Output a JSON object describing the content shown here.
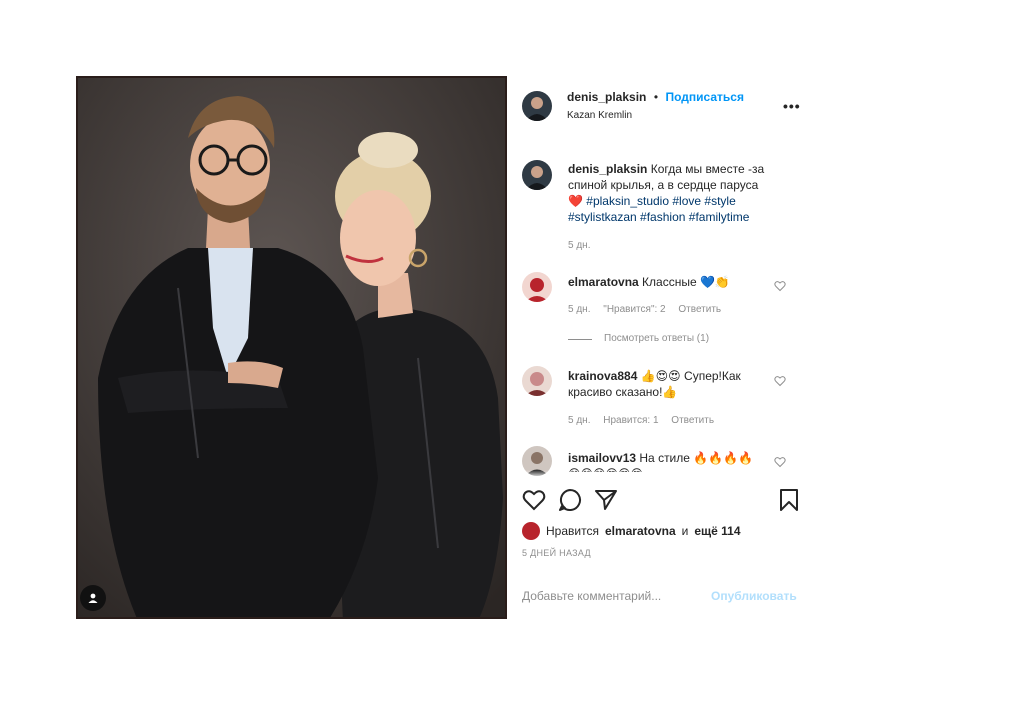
{
  "post": {
    "author": "denis_plaksin",
    "follow_label": "Подписаться",
    "dot": "•",
    "location": "Kazan Kremlin",
    "more_label": "•••"
  },
  "caption": {
    "username": "denis_plaksin",
    "text": "Когда мы вместе -за спиной крылья, а в сердце паруса",
    "emoji": "❤️",
    "hashtags": [
      "#plaksin_studio",
      "#love",
      "#style",
      "#stylistkazan",
      "#fashion",
      "#familytime"
    ],
    "time": "5 дн."
  },
  "comments": [
    {
      "username": "elmaratovna",
      "text": "Классные 💙👏",
      "time": "5 дн.",
      "likes": "\"Нравится\": 2",
      "reply": "Ответить",
      "avatar_color": "#b8242c"
    },
    {
      "username": "krainova884",
      "text": "👍😍😍 Супер!Как красиво сказано!👍",
      "time": "5 дн.",
      "likes": "Нравится: 1",
      "reply": "Ответить",
      "avatar_color": "#c98a8a"
    },
    {
      "username": "ismailovv13",
      "text": "На стиле 🔥🔥🔥🔥 😁😁😁😍😍😍",
      "avatar_color": "#8a7466"
    }
  ],
  "view_replies": "Посмотреть ответы (1)",
  "likes": {
    "prefix": "Нравится",
    "user": "elmaratovna",
    "connector": "и",
    "others": "ещё 114"
  },
  "date": "5 ДНЕЙ НАЗАД",
  "comment_input": {
    "placeholder": "Добавьте комментарий...",
    "publish_label": "Опубликовать"
  },
  "colors": {
    "link_blue": "#0095f6",
    "hashtag": "#00376b",
    "secondary_text": "#8e8e8e",
    "publish_disabled": "#b2dffc"
  },
  "icons": [
    "user-tag-icon",
    "more-icon",
    "heart-icon",
    "comment-icon",
    "share-icon",
    "bookmark-icon"
  ]
}
